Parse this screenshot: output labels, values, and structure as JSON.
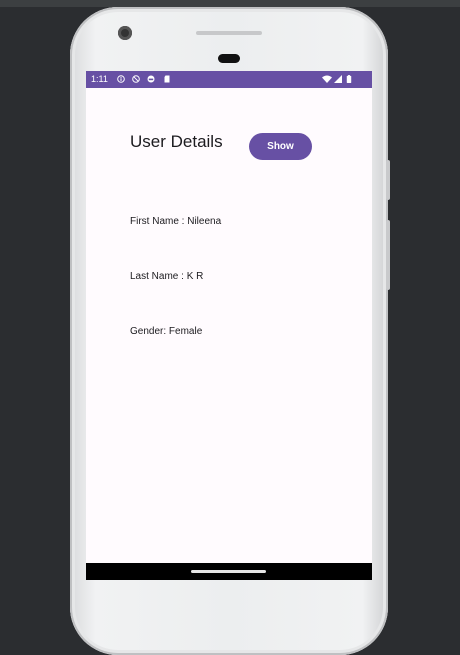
{
  "status_bar": {
    "time": "1:11",
    "left_icons": [
      "info-icon",
      "no-disturb-icon",
      "android-icon",
      "sd-card-icon"
    ],
    "right_icons": [
      "wifi-icon",
      "signal-icon",
      "battery-icon"
    ],
    "color": "#6750a4"
  },
  "header": {
    "title": "User Details",
    "show_button_label": "Show"
  },
  "details": {
    "first_name": "First Name : Nileena",
    "last_name": "Last Name : K R",
    "gender": "Gender: Female"
  },
  "colors": {
    "accent": "#6750a4",
    "background": "#fffbfe",
    "text": "#1c1b1f"
  }
}
